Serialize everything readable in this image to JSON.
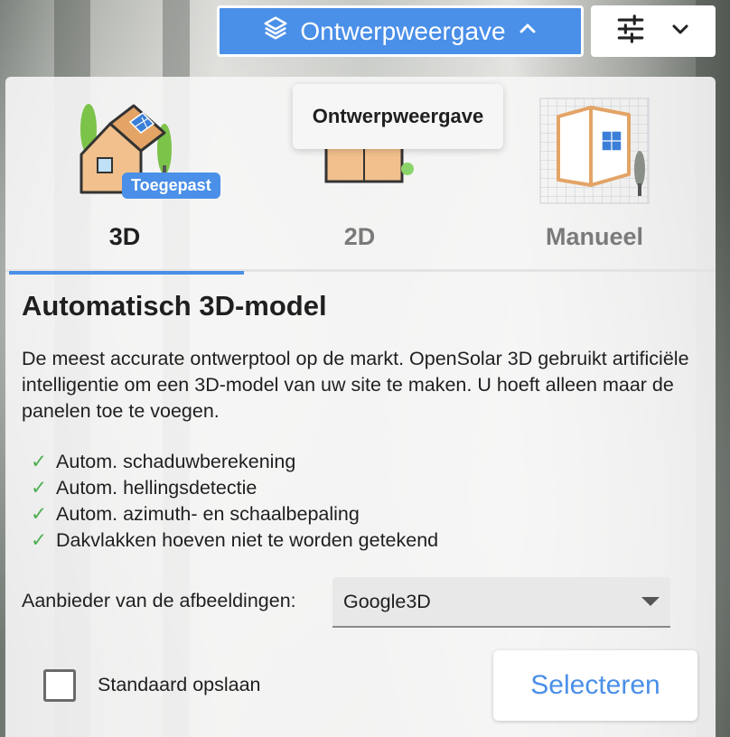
{
  "top_bar": {
    "view_button_label": "Ontwerpweergave",
    "view_icon": "layers-icon",
    "view_chevron_icon": "chevron-up-icon",
    "tools_icon": "sliders-icon",
    "tools_chevron_icon": "chevron-down-icon"
  },
  "tooltip": {
    "text": "Ontwerpweergave"
  },
  "tabs": [
    {
      "label": "3D",
      "icon": "house-3d-icon",
      "badge": "Toegepast",
      "active": true
    },
    {
      "label": "2D",
      "icon": "house-2d-icon",
      "active": false
    },
    {
      "label": "Manueel",
      "icon": "manual-grid-icon",
      "active": false
    }
  ],
  "content": {
    "title": "Automatisch 3D-model",
    "description": "De meest accurate ontwerptool op de markt. OpenSolar 3D gebruikt artificiële intelligentie om een 3D-model van uw site te maken. U hoeft alleen maar de panelen toe te voegen.",
    "features": [
      "Autom. schaduwberekening",
      "Autom. hellingsdetectie",
      "Autom. azimuth- en schaalbepaling",
      "Dakvlakken hoeven niet te worden getekend"
    ],
    "check_symbol": "✓",
    "provider_label": "Aanbieder van de afbeeldingen:",
    "provider_value": "Google3D",
    "checkbox_label": "Standaard opslaan",
    "checkbox_checked": false,
    "select_button": "Selecteren"
  },
  "colors": {
    "accent": "#4a8fe8",
    "check": "#4caf50"
  }
}
